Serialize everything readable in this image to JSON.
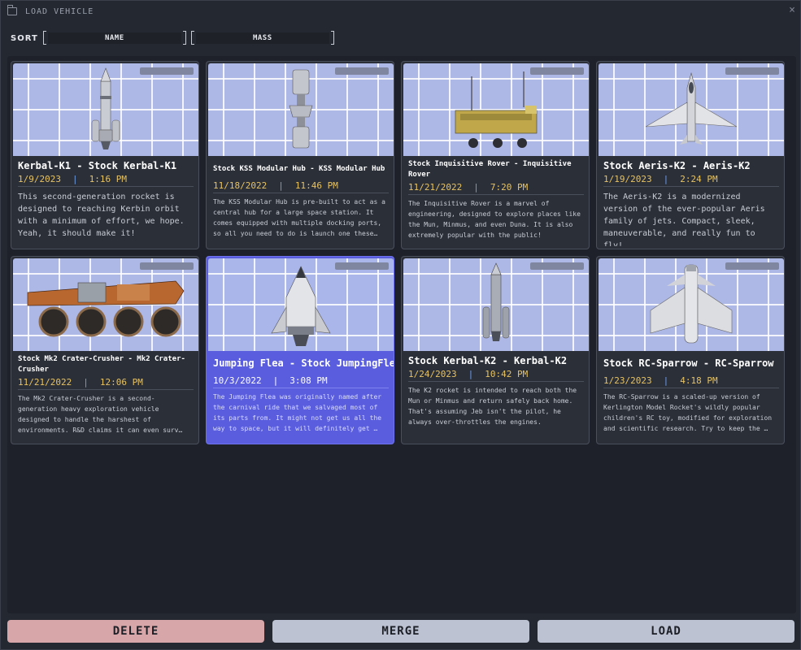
{
  "window": {
    "title": "LOAD VEHICLE",
    "close_glyph": "×",
    "icon": "folder-icon"
  },
  "sort": {
    "label": "SORT",
    "buttons": [
      {
        "label": "NAME"
      },
      {
        "label": "MASS"
      }
    ]
  },
  "colors": {
    "accent_selected": "#5a5ede",
    "date_text": "#e7c262",
    "separator": "#6f9ee8",
    "delete_button": "#d6a6a8",
    "neutral_button": "#bcc2d2"
  },
  "vehicles": [
    {
      "name": "Kerbal-K1 - Stock Kerbal-K1",
      "date": "1/9/2023",
      "sep": "|",
      "time": "1:16 PM",
      "description": "This second-generation rocket is designed to reaching Kerbin orbit with a minimum of effort, we hope. Yeah, it should make it!",
      "thumbnail_icon": "rocket-icon",
      "selected": false
    },
    {
      "name": "Stock KSS Modular Hub - KSS Modular Hub",
      "date": "11/18/2022",
      "sep": "|",
      "time": "11:46 PM",
      "description": "The KSS Modular Hub is pre-built to act as a central hub for a large space station. It comes equipped with multiple docking ports, so all you need to do is launch one these…",
      "thumbnail_icon": "station-hub-icon",
      "selected": false
    },
    {
      "name": "Stock Inquisitive Rover - Inquisitive Rover",
      "date": "11/21/2022",
      "sep": "|",
      "time": "7:20 PM",
      "description": "The Inquisitive Rover is a marvel of engineering, designed to explore places like the Mun, Minmus, and even Duna. It is also extremely popular with the public!",
      "thumbnail_icon": "rover-icon",
      "selected": false
    },
    {
      "name": "Stock Aeris-K2 - Aeris-K2",
      "date": "1/19/2023",
      "sep": "|",
      "time": "2:24 PM",
      "description": "The Aeris-K2 is a modernized version of the ever-popular Aeris family of jets. Compact, sleek, maneuverable, and really fun to fly!",
      "thumbnail_icon": "jet-icon",
      "selected": false
    },
    {
      "name": "Stock Mk2 Crater-Crusher - Mk2 Crater-Crusher",
      "date": "11/21/2022",
      "sep": "|",
      "time": "12:06 PM",
      "description": "The Mk2 Crater-Crusher is a second-generation heavy exploration vehicle designed to handle the harshest of environments. R&D claims it can even surv…",
      "thumbnail_icon": "heavy-rover-icon",
      "selected": false
    },
    {
      "name": "Jumping Flea - Stock JumpingFlea",
      "date": "10/3/2022",
      "sep": "|",
      "time": "3:08 PM",
      "description": "The Jumping Flea was originally named after the carnival ride that we salvaged most of its parts from. It might not get us all the way to space, but it will definitely get …",
      "thumbnail_icon": "capsule-icon",
      "selected": true
    },
    {
      "name": "Stock Kerbal-K2 - Kerbal-K2",
      "date": "1/24/2023",
      "sep": "|",
      "time": "10:42 PM",
      "description": "The K2 rocket is intended to reach both the Mun or Minmus and return safely back home. That's assuming Jeb isn't the pilot, he always over-throttles the engines.",
      "thumbnail_icon": "rocket-icon",
      "selected": false
    },
    {
      "name": "Stock RC-Sparrow - RC-Sparrow",
      "date": "1/23/2023",
      "sep": "|",
      "time": "4:18 PM",
      "description": "The RC-Sparrow is a scaled-up version of Kerlington Model Rocket's wildly popular children's RC toy, modified for exploration and scientific research. Try to keep the …",
      "thumbnail_icon": "plane-icon",
      "selected": false
    }
  ],
  "footer": {
    "delete_label": "DELETE",
    "merge_label": "MERGE",
    "load_label": "LOAD"
  }
}
